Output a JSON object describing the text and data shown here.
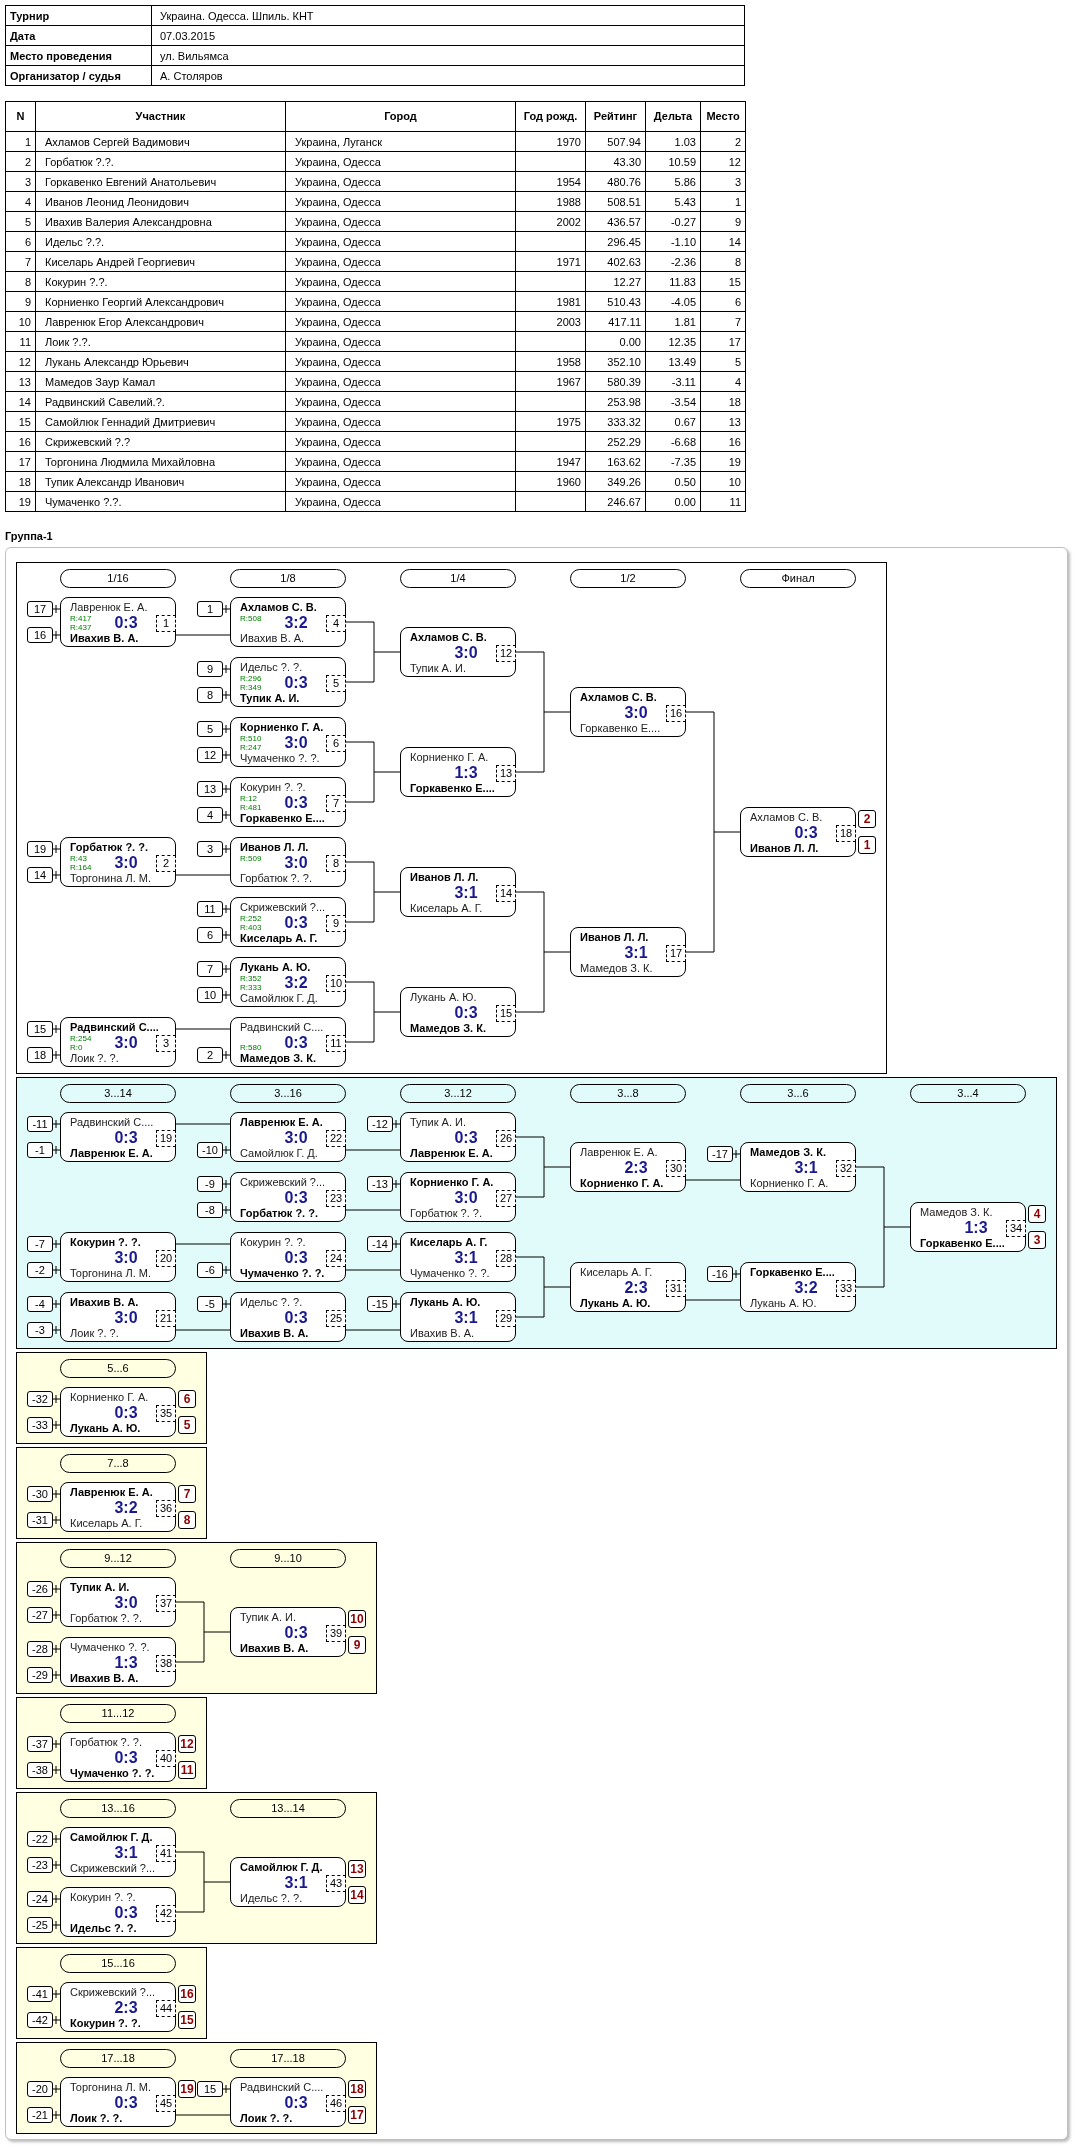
{
  "info": [
    {
      "label": "Турнир",
      "value": "Украина. Одесса. Шпиль. КНТ"
    },
    {
      "label": "Дата",
      "value": "07.03.2015"
    },
    {
      "label": "Место проведения",
      "value": "ул. Вильямса"
    },
    {
      "label": "Организатор / судья",
      "value": "А. Столяров"
    }
  ],
  "participants": {
    "columns": [
      "N",
      "Участник",
      "Город",
      "Год рожд.",
      "Рейтинг",
      "Дельта",
      "Место"
    ],
    "rows": [
      {
        "n": "1",
        "name": "Ахламов Сергей Вадимович",
        "city": "Украина, Луганск",
        "year": "1970",
        "rating": "507.94",
        "delta": "1.03",
        "place": "2"
      },
      {
        "n": "2",
        "name": "Горбатюк ?.?.",
        "city": "Украина, Одесса",
        "rating": "43.30",
        "delta": "10.59",
        "place": "12"
      },
      {
        "n": "3",
        "name": "Горкавенко Евгений Анатольевич",
        "city": "Украина, Одесса",
        "year": "1954",
        "rating": "480.76",
        "delta": "5.86",
        "place": "3"
      },
      {
        "n": "4",
        "name": "Иванов Леонид Леонидович",
        "city": "Украина, Одесса",
        "year": "1988",
        "rating": "508.51",
        "delta": "5.43",
        "place": "1"
      },
      {
        "n": "5",
        "name": "Ивахив Валерия Александровна",
        "city": "Украина, Одесса",
        "year": "2002",
        "rating": "436.57",
        "delta": "-0.27",
        "place": "9"
      },
      {
        "n": "6",
        "name": "Идельс ?.?.",
        "city": "Украина, Одесса",
        "rating": "296.45",
        "delta": "-1.10",
        "place": "14"
      },
      {
        "n": "7",
        "name": "Киселарь Андрей Георгиевич",
        "city": "Украина, Одесса",
        "year": "1971",
        "rating": "402.63",
        "delta": "-2.36",
        "place": "8"
      },
      {
        "n": "8",
        "name": "Кокурин ?.?.",
        "city": "Украина, Одесса",
        "rating": "12.27",
        "delta": "11.83",
        "place": "15"
      },
      {
        "n": "9",
        "name": "Корниенко Георгий Александрович",
        "city": "Украина, Одесса",
        "year": "1981",
        "rating": "510.43",
        "delta": "-4.05",
        "place": "6"
      },
      {
        "n": "10",
        "name": "Лавренюк Егор Александрович",
        "city": "Украина, Одесса",
        "year": "2003",
        "rating": "417.11",
        "delta": "1.81",
        "place": "7"
      },
      {
        "n": "11",
        "name": "Лоик ?.?.",
        "city": "Украина, Одесса",
        "rating": "0.00",
        "delta": "12.35",
        "place": "17"
      },
      {
        "n": "12",
        "name": "Лукань Александр Юрьевич",
        "city": "Украина, Одесса",
        "year": "1958",
        "rating": "352.10",
        "delta": "13.49",
        "place": "5"
      },
      {
        "n": "13",
        "name": "Мамедов Заур Камал",
        "city": "Украина, Одесса",
        "year": "1967",
        "rating": "580.39",
        "delta": "-3.11",
        "place": "4"
      },
      {
        "n": "14",
        "name": "Радвинский Савелий.?.",
        "city": "Украина, Одесса",
        "rating": "253.98",
        "delta": "-3.54",
        "place": "18"
      },
      {
        "n": "15",
        "name": "Самойлюк Геннадий Дмитриевич",
        "city": "Украина, Одесса",
        "year": "1975",
        "rating": "333.32",
        "delta": "0.67",
        "place": "13"
      },
      {
        "n": "16",
        "name": "Скрижевский ?.?",
        "city": "Украина, Одесса",
        "rating": "252.29",
        "delta": "-6.68",
        "place": "16"
      },
      {
        "n": "17",
        "name": "Торгонина Людмила Михайловна",
        "city": "Украина, Одесса",
        "year": "1947",
        "rating": "163.62",
        "delta": "-7.35",
        "place": "19"
      },
      {
        "n": "18",
        "name": "Тупик Александр Иванович",
        "city": "Украина, Одесса",
        "year": "1960",
        "rating": "349.26",
        "delta": "0.50",
        "place": "10"
      },
      {
        "n": "19",
        "name": "Чумаченко ?.?.",
        "city": "Украина, Одесса",
        "rating": "246.67",
        "delta": "0.00",
        "place": "11"
      }
    ]
  },
  "group": {
    "title": "Группа-1",
    "panels": [
      {
        "kind": "main",
        "columns": [
          {
            "header": "1/16",
            "matches": [
              {
                "number": "1",
                "score": "0:3",
                "top": {
                  "name": "Лавренюк Е. А.",
                  "winner": false,
                  "seed": "17",
                  "rating": "R:417"
                },
                "bottom": {
                  "name": "Ивахив В. А.",
                  "winner": true,
                  "seed": "16",
                  "rating": "R:437"
                }
              },
              {
                "number": "2",
                "score": "3:0",
                "top": {
                  "name": "Горбатюк ?. ?.",
                  "winner": true,
                  "seed": "19",
                  "rating": "R:43"
                },
                "bottom": {
                  "name": "Торгонина Л. М.",
                  "winner": false,
                  "seed": "14",
                  "rating": "R:164"
                }
              },
              {
                "number": "3",
                "score": "3:0",
                "top": {
                  "name": "Радвинский С....",
                  "winner": true,
                  "seed": "15",
                  "rating": "R:254"
                },
                "bottom": {
                  "name": "Лоик ?. ?.",
                  "winner": false,
                  "seed": "18",
                  "rating": "R:0"
                }
              }
            ]
          },
          {
            "header": "1/8",
            "matches": [
              {
                "number": "4",
                "score": "3:2",
                "top": {
                  "name": "Ахламов С. В.",
                  "winner": true,
                  "seed": "1",
                  "rating": "R:508"
                },
                "bottom": {
                  "name": "Ивахив В. А.",
                  "winner": false
                }
              },
              {
                "number": "5",
                "score": "0:3",
                "top": {
                  "name": "Идельс ?. ?.",
                  "winner": false,
                  "seed": "9",
                  "rating": "R:296"
                },
                "bottom": {
                  "name": "Тупик А. И.",
                  "winner": true,
                  "seed": "8",
                  "rating": "R:349"
                }
              },
              {
                "number": "6",
                "score": "3:0",
                "top": {
                  "name": "Корниенко Г. А.",
                  "winner": true,
                  "seed": "5",
                  "rating": "R:510"
                },
                "bottom": {
                  "name": "Чумаченко ?. ?.",
                  "winner": false,
                  "seed": "12",
                  "rating": "R:247"
                }
              },
              {
                "number": "7",
                "score": "0:3",
                "top": {
                  "name": "Кокурин ?. ?.",
                  "winner": false,
                  "seed": "13",
                  "rating": "R:12"
                },
                "bottom": {
                  "name": "Горкавенко Е....",
                  "winner": true,
                  "seed": "4",
                  "rating": "R:481"
                }
              },
              {
                "number": "8",
                "score": "3:0",
                "top": {
                  "name": "Иванов Л. Л.",
                  "winner": true,
                  "seed": "3",
                  "rating": "R:509"
                },
                "bottom": {
                  "name": "Горбатюк ?. ?.",
                  "winner": false
                }
              },
              {
                "number": "9",
                "score": "0:3",
                "top": {
                  "name": "Скрижевский ?...",
                  "winner": false,
                  "seed": "11",
                  "rating": "R:252"
                },
                "bottom": {
                  "name": "Киселарь А. Г.",
                  "winner": true,
                  "seed": "6",
                  "rating": "R:403"
                }
              },
              {
                "number": "10",
                "score": "3:2",
                "top": {
                  "name": "Лукань А. Ю.",
                  "winner": true,
                  "seed": "7",
                  "rating": "R:352"
                },
                "bottom": {
                  "name": "Самойлюк Г. Д.",
                  "winner": false,
                  "seed": "10",
                  "rating": "R:333"
                }
              },
              {
                "number": "11",
                "score": "0:3",
                "top": {
                  "name": "Радвинский С....",
                  "winner": false
                },
                "bottom": {
                  "name": "Мамедов З. К.",
                  "winner": true,
                  "seed": "2",
                  "rating": "R:580"
                }
              }
            ]
          },
          {
            "header": "1/4",
            "matches": [
              {
                "number": "12",
                "score": "3:0",
                "top": {
                  "name": "Ахламов С. В.",
                  "winner": true
                },
                "bottom": {
                  "name": "Тупик А. И.",
                  "winner": false
                }
              },
              {
                "number": "13",
                "score": "1:3",
                "top": {
                  "name": "Корниенко Г. А.",
                  "winner": false
                },
                "bottom": {
                  "name": "Горкавенко Е....",
                  "winner": true
                }
              },
              {
                "number": "14",
                "score": "3:1",
                "top": {
                  "name": "Иванов Л. Л.",
                  "winner": true
                },
                "bottom": {
                  "name": "Киселарь А. Г.",
                  "winner": false
                }
              },
              {
                "number": "15",
                "score": "0:3",
                "top": {
                  "name": "Лукань А. Ю.",
                  "winner": false
                },
                "bottom": {
                  "name": "Мамедов З. К.",
                  "winner": true
                }
              }
            ]
          },
          {
            "header": "1/2",
            "matches": [
              {
                "number": "16",
                "score": "3:0",
                "top": {
                  "name": "Ахламов С. В.",
                  "winner": true
                },
                "bottom": {
                  "name": "Горкавенко Е....",
                  "winner": false
                }
              },
              {
                "number": "17",
                "score": "3:1",
                "top": {
                  "name": "Иванов Л. Л.",
                  "winner": true
                },
                "bottom": {
                  "name": "Мамедов З. К.",
                  "winner": false
                }
              }
            ]
          },
          {
            "header": "Финал",
            "matches": [
              {
                "number": "18",
                "score": "0:3",
                "top": {
                  "name": "Ахламов С. В.",
                  "winner": false,
                  "rank": "2"
                },
                "bottom": {
                  "name": "Иванов Л. Л.",
                  "winner": true,
                  "rank": "1"
                }
              }
            ]
          }
        ]
      },
      {
        "kind": "consolation",
        "columns": [
          {
            "header": "3...14",
            "matches": [
              {
                "number": "19",
                "score": "0:3",
                "top": {
                  "name": "Радвинский С....",
                  "winner": false,
                  "seed": "-11"
                },
                "bottom": {
                  "name": "Лавренюк Е. А.",
                  "winner": true,
                  "seed": "-1"
                }
              },
              {
                "number": "20",
                "score": "3:0",
                "top": {
                  "name": "Кокурин ?. ?.",
                  "winner": true,
                  "seed": "-7"
                },
                "bottom": {
                  "name": "Торгонина Л. М.",
                  "winner": false,
                  "seed": "-2"
                }
              },
              {
                "number": "21",
                "score": "3:0",
                "top": {
                  "name": "Ивахив В. А.",
                  "winner": true,
                  "seed": "-4"
                },
                "bottom": {
                  "name": "Лоик ?. ?.",
                  "winner": false,
                  "seed": "-3"
                }
              }
            ]
          },
          {
            "header": "3...16",
            "matches": [
              {
                "number": "22",
                "score": "3:0",
                "top": {
                  "name": "Лавренюк Е. А.",
                  "winner": true
                },
                "bottom": {
                  "name": "Самойлюк Г. Д.",
                  "winner": false,
                  "seed": "-10"
                }
              },
              {
                "number": "23",
                "score": "0:3",
                "top": {
                  "name": "Скрижевский ?...",
                  "winner": false,
                  "seed": "-9"
                },
                "bottom": {
                  "name": "Горбатюк ?. ?.",
                  "winner": true,
                  "seed": "-8"
                }
              },
              {
                "number": "24",
                "score": "0:3",
                "top": {
                  "name": "Кокурин ?. ?.",
                  "winner": false
                },
                "bottom": {
                  "name": "Чумаченко ?. ?.",
                  "winner": true,
                  "seed": "-6"
                }
              },
              {
                "number": "25",
                "score": "0:3",
                "top": {
                  "name": "Идельс ?. ?.",
                  "winner": false,
                  "seed": "-5"
                },
                "bottom": {
                  "name": "Ивахив В. А.",
                  "winner": true
                }
              }
            ]
          },
          {
            "header": "3...12",
            "matches": [
              {
                "number": "26",
                "score": "0:3",
                "top": {
                  "name": "Тупик А. И.",
                  "winner": false,
                  "seed": "-12"
                },
                "bottom": {
                  "name": "Лавренюк Е. А.",
                  "winner": true
                }
              },
              {
                "number": "27",
                "score": "3:0",
                "top": {
                  "name": "Корниенко Г. А.",
                  "winner": true,
                  "seed": "-13"
                },
                "bottom": {
                  "name": "Горбатюк ?. ?.",
                  "winner": false
                }
              },
              {
                "number": "28",
                "score": "3:1",
                "top": {
                  "name": "Киселарь А. Г.",
                  "winner": true,
                  "seed": "-14"
                },
                "bottom": {
                  "name": "Чумаченко ?. ?.",
                  "winner": false
                }
              },
              {
                "number": "29",
                "score": "3:1",
                "top": {
                  "name": "Лукань А. Ю.",
                  "winner": true,
                  "seed": "-15"
                },
                "bottom": {
                  "name": "Ивахив В. А.",
                  "winner": false
                }
              }
            ]
          },
          {
            "header": "3...8",
            "matches": [
              {
                "number": "30",
                "score": "2:3",
                "top": {
                  "name": "Лавренюк Е. А.",
                  "winner": false
                },
                "bottom": {
                  "name": "Корниенко Г. А.",
                  "winner": true
                }
              },
              {
                "number": "31",
                "score": "2:3",
                "top": {
                  "name": "Киселарь А. Г.",
                  "winner": false
                },
                "bottom": {
                  "name": "Лукань А. Ю.",
                  "winner": true
                }
              }
            ]
          },
          {
            "header": "3...6",
            "matches": [
              {
                "number": "32",
                "score": "3:1",
                "top": {
                  "name": "Мамедов З. К.",
                  "winner": true,
                  "seed": "-17"
                },
                "bottom": {
                  "name": "Корниенко Г. А.",
                  "winner": false
                }
              },
              {
                "number": "33",
                "score": "3:2",
                "top": {
                  "name": "Горкавенко Е....",
                  "winner": true,
                  "seed": "-16"
                },
                "bottom": {
                  "name": "Лукань А. Ю.",
                  "winner": false
                }
              }
            ]
          },
          {
            "header": "3...4",
            "matches": [
              {
                "number": "34",
                "score": "1:3",
                "top": {
                  "name": "Мамедов З. К.",
                  "winner": false,
                  "rank": "4"
                },
                "bottom": {
                  "name": "Горкавенко Е....",
                  "winner": true,
                  "rank": "3"
                }
              }
            ]
          }
        ]
      },
      {
        "kind": "placement",
        "columns": [
          {
            "header": "5...6",
            "matches": [
              {
                "number": "35",
                "score": "0:3",
                "top": {
                  "name": "Корниенко Г. А.",
                  "winner": false,
                  "seed": "-32",
                  "rank": "6"
                },
                "bottom": {
                  "name": "Лукань А. Ю.",
                  "winner": true,
                  "seed": "-33",
                  "rank": "5"
                }
              }
            ]
          }
        ]
      },
      {
        "kind": "placement",
        "columns": [
          {
            "header": "7...8",
            "matches": [
              {
                "number": "36",
                "score": "3:2",
                "top": {
                  "name": "Лавренюк Е. А.",
                  "winner": true,
                  "seed": "-30",
                  "rank": "7"
                },
                "bottom": {
                  "name": "Киселарь А. Г.",
                  "winner": false,
                  "seed": "-31",
                  "rank": "8"
                }
              }
            ]
          }
        ]
      },
      {
        "kind": "placement",
        "columns": [
          {
            "header": "9...12",
            "matches": [
              {
                "number": "37",
                "score": "3:0",
                "top": {
                  "name": "Тупик А. И.",
                  "winner": true,
                  "seed": "-26"
                },
                "bottom": {
                  "name": "Горбатюк ?. ?.",
                  "winner": false,
                  "seed": "-27"
                }
              },
              {
                "number": "38",
                "score": "1:3",
                "top": {
                  "name": "Чумаченко ?. ?.",
                  "winner": false,
                  "seed": "-28"
                },
                "bottom": {
                  "name": "Ивахив В. А.",
                  "winner": true,
                  "seed": "-29"
                }
              }
            ]
          },
          {
            "header": "9...10",
            "matches": [
              {
                "number": "39",
                "score": "0:3",
                "top": {
                  "name": "Тупик А. И.",
                  "winner": false,
                  "rank": "10"
                },
                "bottom": {
                  "name": "Ивахив В. А.",
                  "winner": true,
                  "rank": "9"
                }
              }
            ]
          }
        ]
      },
      {
        "kind": "placement",
        "columns": [
          {
            "header": "11...12",
            "matches": [
              {
                "number": "40",
                "score": "0:3",
                "top": {
                  "name": "Горбатюк ?. ?.",
                  "winner": false,
                  "seed": "-37",
                  "rank": "12"
                },
                "bottom": {
                  "name": "Чумаченко ?. ?.",
                  "winner": true,
                  "seed": "-38",
                  "rank": "11"
                }
              }
            ]
          }
        ]
      },
      {
        "kind": "placement",
        "columns": [
          {
            "header": "13...16",
            "matches": [
              {
                "number": "41",
                "score": "3:1",
                "top": {
                  "name": "Самойлюк Г. Д.",
                  "winner": true,
                  "seed": "-22"
                },
                "bottom": {
                  "name": "Скрижевский ?...",
                  "winner": false,
                  "seed": "-23"
                }
              },
              {
                "number": "42",
                "score": "0:3",
                "top": {
                  "name": "Кокурин ?. ?.",
                  "winner": false,
                  "seed": "-24"
                },
                "bottom": {
                  "name": "Идельс ?. ?.",
                  "winner": true,
                  "seed": "-25"
                }
              }
            ]
          },
          {
            "header": "13...14",
            "matches": [
              {
                "number": "43",
                "score": "3:1",
                "top": {
                  "name": "Самойлюк Г. Д.",
                  "winner": true,
                  "rank": "13"
                },
                "bottom": {
                  "name": "Идельс ?. ?.",
                  "winner": false,
                  "rank": "14"
                }
              }
            ]
          }
        ]
      },
      {
        "kind": "placement",
        "columns": [
          {
            "header": "15...16",
            "matches": [
              {
                "number": "44",
                "score": "2:3",
                "top": {
                  "name": "Скрижевский ?...",
                  "winner": false,
                  "seed": "-41",
                  "rank": "16"
                },
                "bottom": {
                  "name": "Кокурин ?. ?.",
                  "winner": true,
                  "seed": "-42",
                  "rank": "15"
                }
              }
            ]
          }
        ]
      },
      {
        "kind": "placement",
        "columns": [
          {
            "header": "17...18",
            "matches": [
              {
                "number": "45",
                "score": "0:3",
                "top": {
                  "name": "Торгонина Л. М.",
                  "winner": false,
                  "seed": "-20",
                  "rank": "19"
                },
                "bottom": {
                  "name": "Лоик ?. ?.",
                  "winner": true,
                  "seed": "-21"
                }
              }
            ]
          },
          {
            "header": "17...18",
            "matches": [
              {
                "number": "46",
                "score": "0:3",
                "top": {
                  "name": "Радвинский С....",
                  "winner": false,
                  "seed": "15",
                  "rank": "18"
                },
                "bottom": {
                  "name": "Лоик ?. ?.",
                  "winner": true,
                  "rank": "17"
                }
              }
            ]
          }
        ]
      }
    ]
  }
}
